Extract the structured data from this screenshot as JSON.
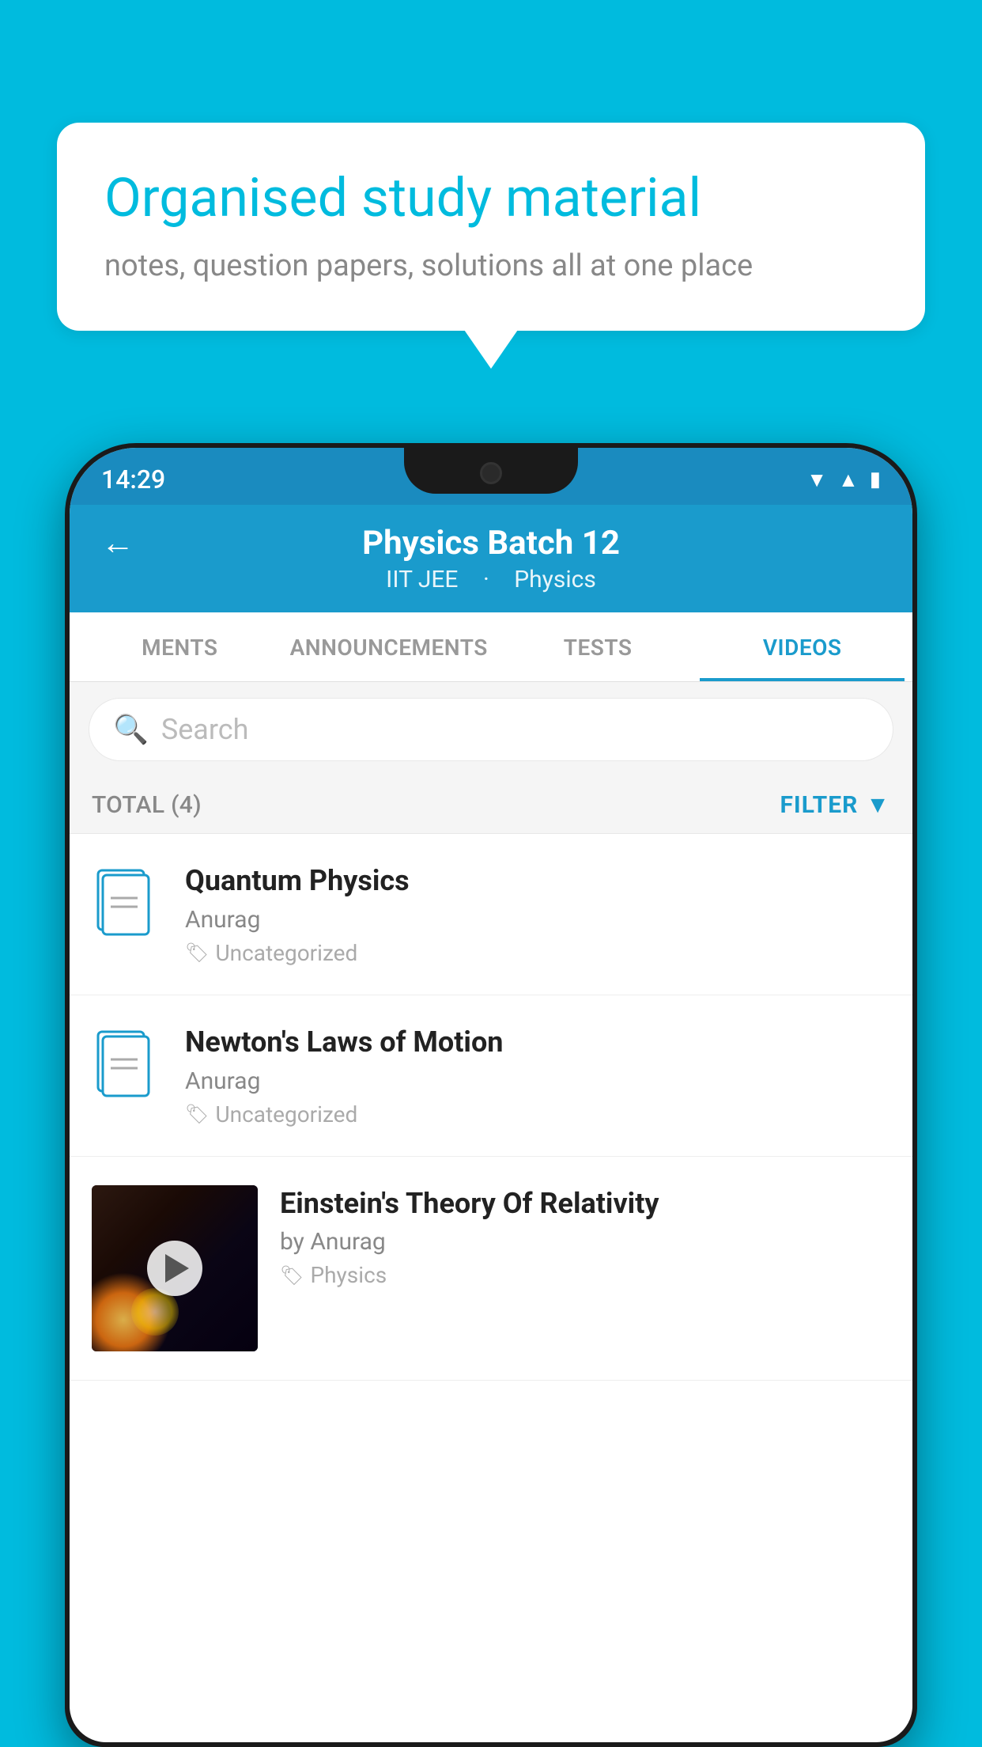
{
  "background_color": "#00BBDE",
  "speech_bubble": {
    "title": "Organised study material",
    "subtitle": "notes, question papers, solutions all at one place"
  },
  "phone": {
    "status_bar": {
      "time": "14:29"
    },
    "header": {
      "title": "Physics Batch 12",
      "subtitle_part1": "IIT JEE",
      "subtitle_part2": "Physics",
      "back_label": "←"
    },
    "tabs": [
      {
        "label": "MENTS",
        "active": false
      },
      {
        "label": "ANNOUNCEMENTS",
        "active": false
      },
      {
        "label": "TESTS",
        "active": false
      },
      {
        "label": "VIDEOS",
        "active": true
      }
    ],
    "search": {
      "placeholder": "Search"
    },
    "filter_bar": {
      "total_label": "TOTAL (4)",
      "filter_label": "FILTER"
    },
    "videos": [
      {
        "id": 1,
        "title": "Quantum Physics",
        "author": "Anurag",
        "tag": "Uncategorized",
        "has_thumbnail": false
      },
      {
        "id": 2,
        "title": "Newton's Laws of Motion",
        "author": "Anurag",
        "tag": "Uncategorized",
        "has_thumbnail": false
      },
      {
        "id": 3,
        "title": "Einstein's Theory Of Relativity",
        "author": "by Anurag",
        "tag": "Physics",
        "has_thumbnail": true
      }
    ]
  }
}
